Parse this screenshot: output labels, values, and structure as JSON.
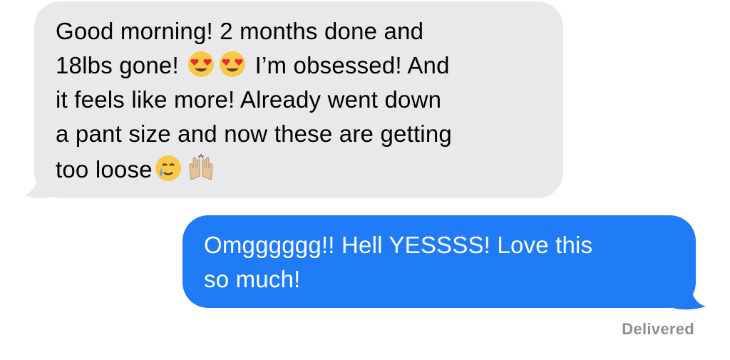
{
  "thread": {
    "received_message": {
      "line1": "Good morning! 2 months done and",
      "line2_a": "18lbs gone!",
      "line2_b": "I’m obsessed! And",
      "line3": "it feels like more! Already went down",
      "line4": "a pant size and now these are getting",
      "line5": "too loose",
      "emojis": [
        "heart-eyes-emoji",
        "heart-eyes-emoji",
        "smiling-face-with-tear-emoji",
        "raising-hands-emoji"
      ]
    },
    "sent_message": {
      "line1": "Omgggggg!! Hell YESSSS! Love this",
      "line2": "so much!"
    },
    "delivery_status": "Delivered"
  },
  "colors": {
    "received_bubble": "#e9e9eb",
    "sent_bubble": "#1f7bf6",
    "status_text": "#8e8e93"
  }
}
